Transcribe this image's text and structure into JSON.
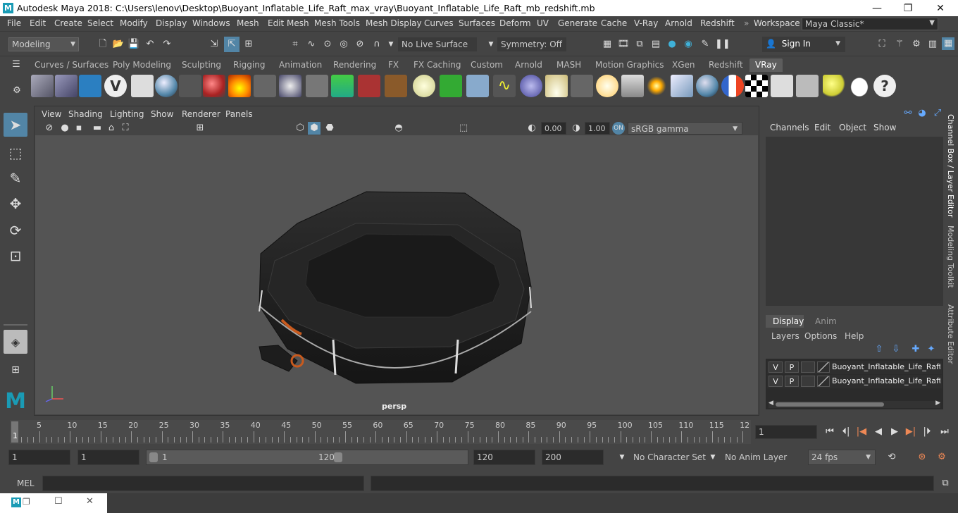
{
  "window": {
    "title": "Autodesk Maya 2018: C:\\Users\\lenov\\Desktop\\Buoyant_Inflatable_Life_Raft_max_vray\\Buoyant_Inflatable_Life_Raft_mb_redshift.mb",
    "minimize": "—",
    "maximize": "❐",
    "close": "✕"
  },
  "menubar": {
    "items": [
      "File",
      "Edit",
      "Create",
      "Select",
      "Modify",
      "Display",
      "Windows",
      "Mesh",
      "Edit Mesh",
      "Mesh Tools",
      "Mesh Display",
      "Curves",
      "Surfaces",
      "Deform",
      "UV",
      "Generate",
      "Cache",
      "V-Ray",
      "Arnold",
      "Redshift"
    ],
    "workspace_label": "Workspace :",
    "workspace_value": "Maya Classic*"
  },
  "statusline": {
    "mode": "Modeling",
    "live_surface": "No Live Surface",
    "symmetry": "Symmetry: Off",
    "sign_in": "Sign In"
  },
  "shelf": {
    "tabs": [
      "Curves / Surfaces",
      "Poly Modeling",
      "Sculpting",
      "Rigging",
      "Animation",
      "Rendering",
      "FX",
      "FX Caching",
      "Custom",
      "Arnold",
      "MASH",
      "Motion Graphics",
      "XGen",
      "Redshift",
      "VRay"
    ],
    "active_tab": "VRay"
  },
  "viewport": {
    "menus": [
      "View",
      "Shading",
      "Lighting",
      "Show",
      "Renderer",
      "Panels"
    ],
    "exposure": "0.00",
    "gamma": "1.00",
    "color_space": "sRGB gamma",
    "camera_label": "persp"
  },
  "channelbox": {
    "menus": [
      "Channels",
      "Edit",
      "Object",
      "Show"
    ],
    "side_tabs": [
      "Channel Box / Layer Editor",
      "Modeling Toolkit",
      "Attribute Editor"
    ]
  },
  "layers": {
    "tabs": [
      "Display",
      "Anim"
    ],
    "menus": [
      "Layers",
      "Options",
      "Help"
    ],
    "rows": [
      {
        "v": "V",
        "p": "P",
        "name": "Buoyant_Inflatable_Life_Raft_la"
      },
      {
        "v": "V",
        "p": "P",
        "name": "Buoyant_Inflatable_Life_Raft_la"
      }
    ]
  },
  "timeline": {
    "ticks": [
      "5",
      "10",
      "15",
      "20",
      "25",
      "30",
      "35",
      "40",
      "45",
      "50",
      "55",
      "60",
      "65",
      "70",
      "75",
      "80",
      "85",
      "90",
      "95",
      "100",
      "105",
      "110",
      "115",
      "12"
    ],
    "current_frame_marker": "1",
    "current_frame": "1"
  },
  "range": {
    "start": "1",
    "playback_start": "1",
    "slider_start": "1",
    "slider_end": "120",
    "playback_end": "120",
    "end": "200",
    "character_set": "No Character Set",
    "anim_layer": "No Anim Layer",
    "fps": "24 fps"
  },
  "cmdline": {
    "label": "MEL"
  },
  "colors": {
    "bg": "#444444",
    "viewport_bg": "#545454",
    "active_tab": "#5d5d5d",
    "field_bg": "#2b2b2b",
    "highlight": "#5285a6"
  }
}
